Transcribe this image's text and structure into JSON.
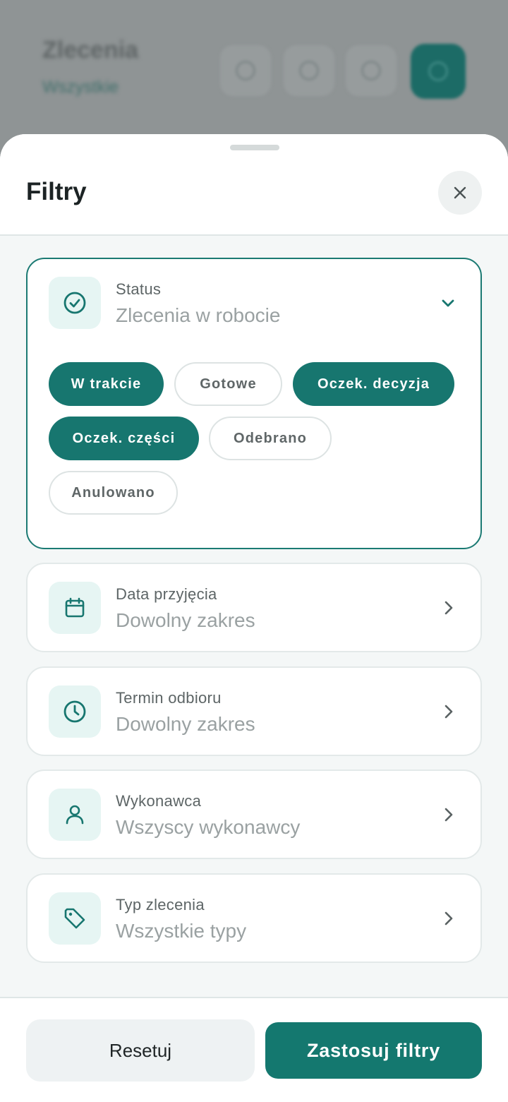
{
  "background": {
    "title": "Zlecenia",
    "subtitle": "Wszystkie"
  },
  "sheet": {
    "title": "Filtry",
    "close_icon": "close-icon"
  },
  "status": {
    "label": "Status",
    "value": "Zlecenia w robocie",
    "icon": "check-circle-icon",
    "expanded": true,
    "chips": [
      {
        "label": "W trakcie",
        "selected": true
      },
      {
        "label": "Gotowe",
        "selected": false
      },
      {
        "label": "Oczek. decyzja",
        "selected": true
      },
      {
        "label": "Oczek. części",
        "selected": true
      },
      {
        "label": "Odebrano",
        "selected": false
      },
      {
        "label": "Anulowano",
        "selected": false
      }
    ]
  },
  "filters": [
    {
      "label": "Data przyjęcia",
      "value": "Dowolny zakres",
      "icon": "calendar-icon"
    },
    {
      "label": "Termin odbioru",
      "value": "Dowolny zakres",
      "icon": "clock-icon"
    },
    {
      "label": "Wykonawca",
      "value": "Wszyscy wykonawcy",
      "icon": "user-icon"
    },
    {
      "label": "Typ zlecenia",
      "value": "Wszystkie typy",
      "icon": "tag-icon"
    }
  ],
  "footer": {
    "reset_label": "Resetuj",
    "apply_label": "Zastosuj filtry"
  },
  "colors": {
    "accent": "#17766f",
    "accent_light": "#e6f5f3",
    "overlay": "#8e9394"
  }
}
